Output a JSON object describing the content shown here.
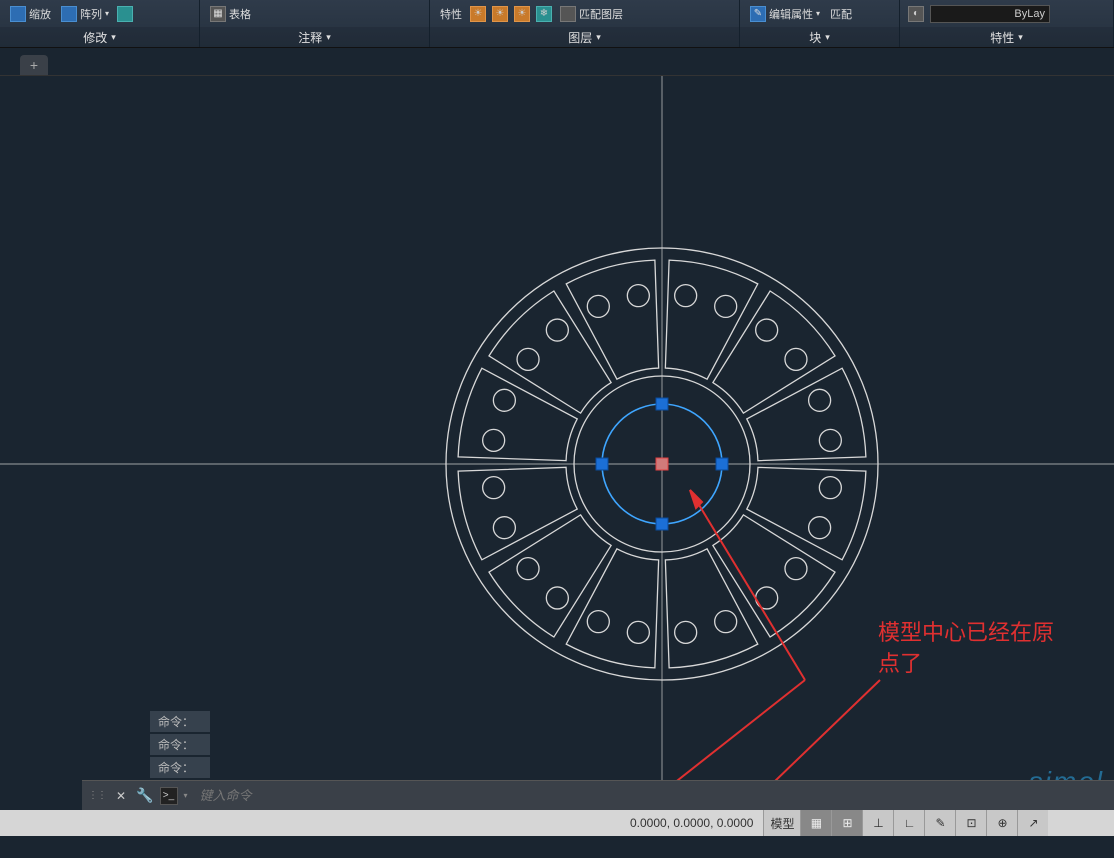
{
  "ribbon": {
    "modify": {
      "title": "修改",
      "scale": "缩放",
      "array": "阵列"
    },
    "annotate": {
      "title": "注释",
      "table": "表格"
    },
    "layer": {
      "title": "图层",
      "props": "特性",
      "match": "匹配图层"
    },
    "block": {
      "title": "块",
      "edit": "编辑属性",
      "match": "匹配"
    },
    "properties": {
      "title": "特性",
      "bylayer": "ByLay"
    }
  },
  "cmd_history": {
    "l1": "命令：",
    "l2": "命令：",
    "l3": "命令："
  },
  "cmd_input_placeholder": "键入命令",
  "annotation": {
    "line1": "模型中心已经在原",
    "line2": "点了"
  },
  "status": {
    "coords": "0.0000, 0.0000, 0.0000",
    "model": "模型"
  },
  "watermark": "simol"
}
